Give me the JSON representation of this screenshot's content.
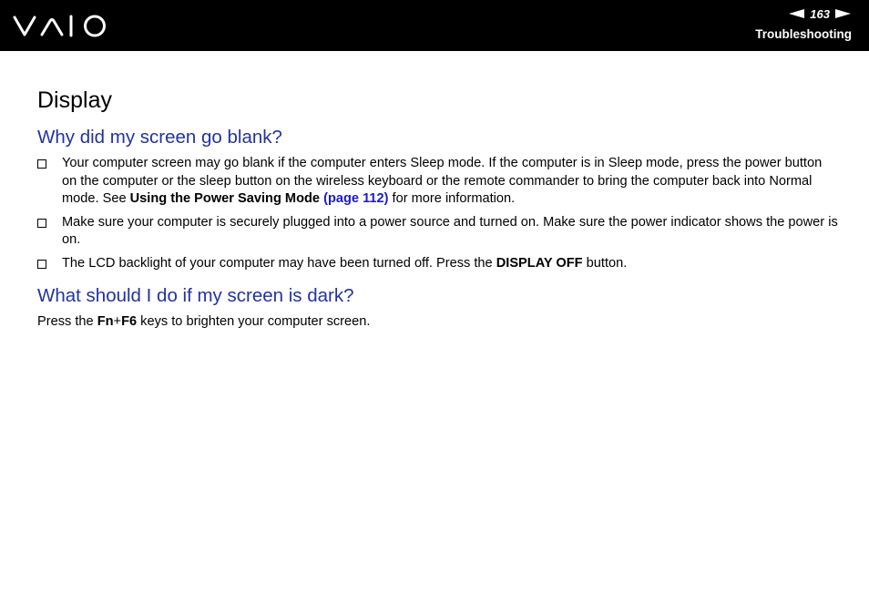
{
  "header": {
    "logo_alt": "VAIO",
    "page_number": "163",
    "section": "Troubleshooting"
  },
  "page": {
    "title": "Display"
  },
  "q1": {
    "heading": "Why did my screen go blank?",
    "bullets": [
      {
        "text_before": "Your computer screen may go blank if the computer enters Sleep mode. If the computer is in Sleep mode, press the power button on the computer or the sleep button on the wireless keyboard or the remote commander to bring the computer back into Normal mode. See ",
        "bold": "Using the Power Saving Mode",
        "link": "(page 112)",
        "text_after": " for more information."
      },
      {
        "text": "Make sure your computer is securely plugged into a power source and turned on. Make sure the power indicator shows the power is on."
      },
      {
        "text_before": "The LCD backlight of your computer may have been turned off. Press the ",
        "bold": "DISPLAY OFF",
        "text_after": " button."
      }
    ]
  },
  "q2": {
    "heading": "What should I do if my screen is dark?",
    "answer_before": "Press the ",
    "key1": "Fn",
    "plus": "+",
    "key2": "F6",
    "answer_after": " keys to brighten your computer screen."
  }
}
